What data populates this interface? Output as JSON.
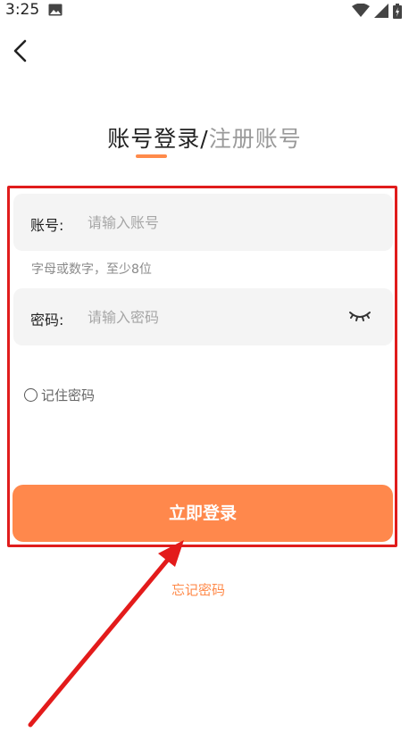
{
  "status_bar": {
    "time": "3:25"
  },
  "tabs": {
    "login_label": "账号登录",
    "separator": "/",
    "register_label": "注册账号"
  },
  "account_field": {
    "label": "账号:",
    "placeholder": "请输入账号",
    "value": ""
  },
  "account_hint": "字母或数字，至少8位",
  "password_field": {
    "label": "密码:",
    "placeholder": "请输入密码",
    "value": ""
  },
  "remember": {
    "label": "记住密码",
    "checked": false
  },
  "login_button": {
    "label": "立即登录"
  },
  "forgot_password": {
    "label": "忘记密码"
  },
  "colors": {
    "accent": "#ff884c",
    "annotation_red": "#e01c1c"
  },
  "icons": {
    "back": "back-arrow-icon",
    "eye": "eye-closed-icon",
    "image": "image-icon",
    "wifi": "wifi-icon",
    "signal": "signal-icon",
    "battery": "battery-icon"
  }
}
